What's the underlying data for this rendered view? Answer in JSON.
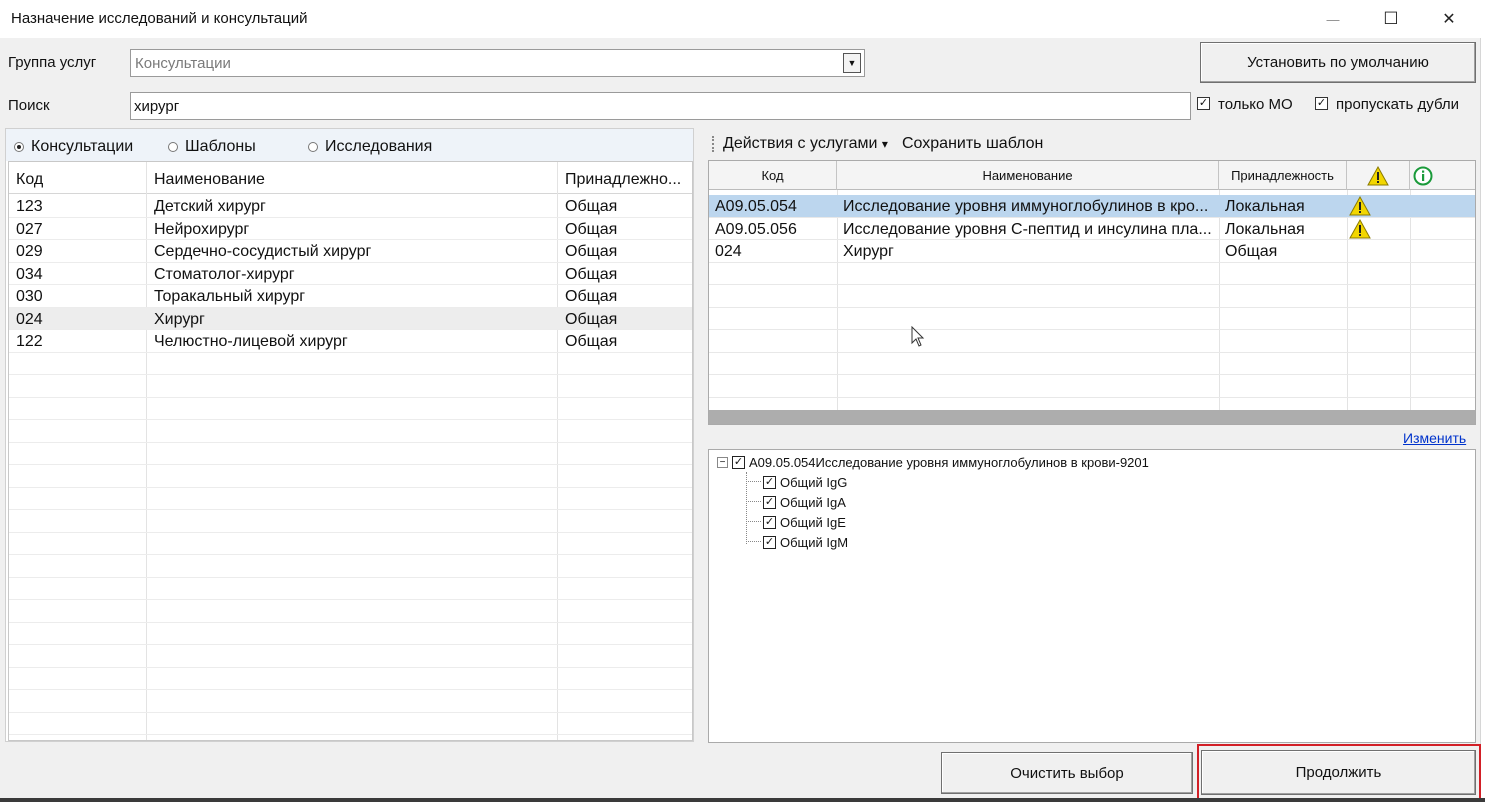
{
  "window": {
    "title": "Назначение исследований и консультаций",
    "minimize": "—",
    "maximize": "☐",
    "close": "✕"
  },
  "filters": {
    "group_label": "Группа услуг",
    "group_value": "Консультации",
    "search_label": "Поиск",
    "search_value": "хирург",
    "default_button": "Установить по умолчанию",
    "only_mo_label": "только МО",
    "only_mo_checked": true,
    "skip_dupes_label": "пропускать дубли",
    "skip_dupes_checked": true
  },
  "left_panel": {
    "radios": [
      {
        "label": "Консультации",
        "selected": true
      },
      {
        "label": "Шаблоны",
        "selected": false
      },
      {
        "label": "Исследования",
        "selected": false
      }
    ],
    "columns": [
      "Код",
      "Наименование",
      "Принадлежно..."
    ],
    "rows": [
      {
        "code": "123",
        "name": "Детский хирург",
        "owner": "Общая"
      },
      {
        "code": "027",
        "name": "Нейрохирург",
        "owner": "Общая"
      },
      {
        "code": "029",
        "name": "Сердечно-сосудистый хирург",
        "owner": "Общая"
      },
      {
        "code": "034",
        "name": "Стоматолог-хирург",
        "owner": "Общая"
      },
      {
        "code": "030",
        "name": "Торакальный хирург",
        "owner": "Общая"
      },
      {
        "code": "024",
        "name": "Хирург",
        "owner": "Общая"
      },
      {
        "code": "122",
        "name": "Челюстно-лицевой хирург",
        "owner": "Общая"
      }
    ],
    "highlighted_row": 5
  },
  "right_panel": {
    "toolbar": {
      "actions": "Действия с услугами",
      "actions_arrow": "▾",
      "save_template": "Сохранить шаблон"
    },
    "columns": [
      "Код",
      "Наименование",
      "Принадлежность"
    ],
    "rows": [
      {
        "code": "A09.05.054",
        "name": "Исследование уровня иммуноглобулинов в кро...",
        "owner": "Локальная",
        "warn": true
      },
      {
        "code": "A09.05.056",
        "name": "Исследование уровня С-пептид и инсулина пла...",
        "owner": "Локальная",
        "warn": true
      },
      {
        "code": "024",
        "name": "Хирург",
        "owner": "Общая",
        "warn": false
      }
    ],
    "selected_row": 0,
    "change_link": "Изменить",
    "tree": {
      "root": "A09.05.054Исследование уровня иммуноглобулинов в крови-9201",
      "children": [
        "Общий IgG",
        "Общий IgA",
        "Общий IgE",
        "Общий IgM"
      ]
    }
  },
  "footer": {
    "clear_button": "Очистить выбор",
    "continue_button": "Продолжить"
  },
  "colors": {
    "selection": "#bcd6ee",
    "warning": "#f2d600",
    "info": "#1a9a3a",
    "link": "#0033cc",
    "highlight_border": "#d21f26"
  }
}
